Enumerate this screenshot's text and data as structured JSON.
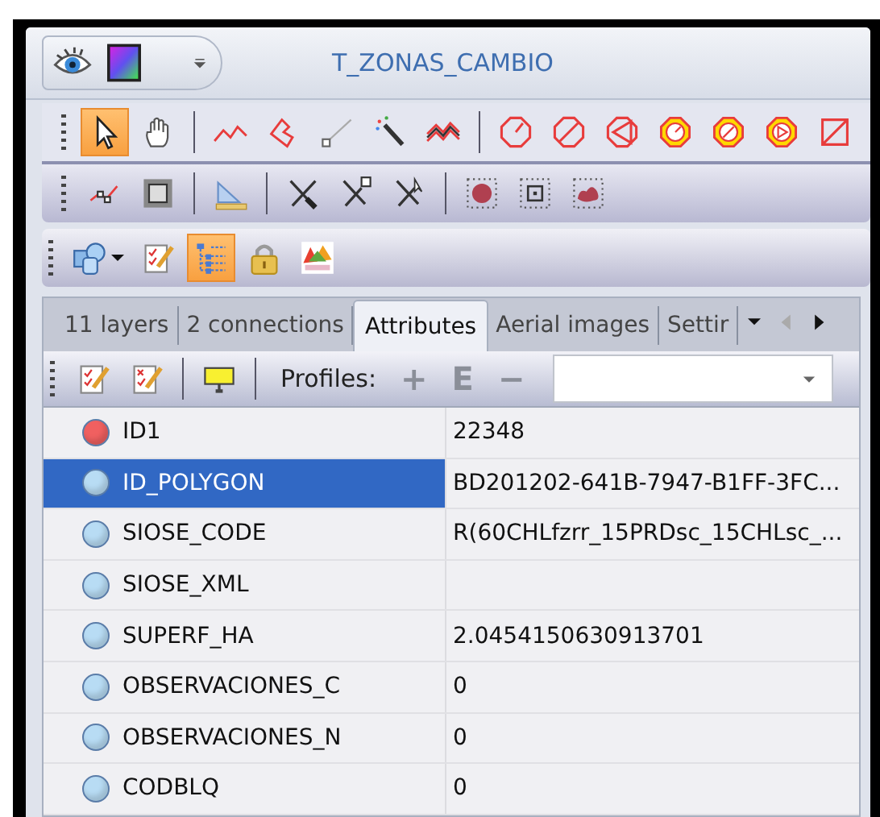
{
  "window": {
    "title": "T_ZONAS_CAMBIO"
  },
  "quick_access": [
    {
      "kind": "eye"
    },
    {
      "kind": "palette"
    },
    {
      "kind": "customize"
    }
  ],
  "toolbars": [
    [
      {
        "kind": "pointer",
        "pressed": true
      },
      {
        "kind": "hand",
        "pressed": false
      },
      {
        "kind": "separator"
      },
      {
        "kind": "polyline",
        "pressed": false
      },
      {
        "kind": "polygon",
        "pressed": false
      },
      {
        "kind": "segment",
        "pressed": false
      },
      {
        "kind": "wand",
        "pressed": false
      },
      {
        "kind": "zigzag",
        "pressed": false
      },
      {
        "kind": "separator"
      },
      {
        "kind": "octagon",
        "pressed": false
      },
      {
        "kind": "octaslash",
        "pressed": false
      },
      {
        "kind": "octaplay",
        "pressed": false
      },
      {
        "kind": "ring",
        "pressed": false
      },
      {
        "kind": "ringslash",
        "pressed": false
      },
      {
        "kind": "ringplay",
        "pressed": false
      },
      {
        "kind": "squareslash",
        "pressed": false
      }
    ],
    [
      {
        "kind": "vertices",
        "pressed": false
      },
      {
        "kind": "hatch",
        "pressed": false
      },
      {
        "kind": "separator"
      },
      {
        "kind": "setsquare",
        "pressed": false
      },
      {
        "kind": "separator"
      },
      {
        "kind": "knife",
        "pressed": false
      },
      {
        "kind": "knifesquare",
        "pressed": false
      },
      {
        "kind": "knifecursor",
        "pressed": false
      },
      {
        "kind": "separator"
      },
      {
        "kind": "dotcircle",
        "pressed": false
      },
      {
        "kind": "dotsquare",
        "pressed": false
      },
      {
        "kind": "dotblob",
        "pressed": false
      }
    ],
    [
      {
        "kind": "shapes",
        "pressed": false
      },
      {
        "kind": "checklist",
        "pressed": false
      },
      {
        "kind": "tree",
        "pressed": true
      },
      {
        "kind": "lock",
        "pressed": false
      },
      {
        "kind": "logo",
        "pressed": false
      }
    ]
  ],
  "tabs": [
    {
      "label": "11 layers",
      "selected": false
    },
    {
      "label": "2 connections",
      "selected": false
    },
    {
      "label": "Attributes",
      "selected": true
    },
    {
      "label": "Aerial images",
      "selected": false
    },
    {
      "label": "Settir",
      "selected": false
    }
  ],
  "tab_nav": [
    {
      "kind": "menu",
      "disabled": false
    },
    {
      "kind": "left",
      "disabled": true
    },
    {
      "kind": "right",
      "disabled": false
    }
  ],
  "attr_toolbar": {
    "tools": [
      {
        "kind": "checklist"
      },
      {
        "kind": "checkx"
      },
      {
        "kind": "separator"
      },
      {
        "kind": "sign"
      },
      {
        "kind": "separator"
      }
    ],
    "profiles_label": "Profiles:",
    "profile_buttons": [
      {
        "label": "+",
        "disabled": true
      },
      {
        "label": "E",
        "disabled": true
      },
      {
        "label": "−",
        "disabled": true
      }
    ]
  },
  "rows": [
    {
      "name": "ID1",
      "value": "22348",
      "color": "#f06060",
      "selected": false
    },
    {
      "name": "ID_POLYGON",
      "value": "BD201202-641B-7947-B1FF-3FC...",
      "color": "#b8dcf4",
      "selected": true
    },
    {
      "name": "SIOSE_CODE",
      "value": "R(60CHLfzrr_15PRDsc_15CHLsc_...",
      "color": "#b8dcf4",
      "selected": false
    },
    {
      "name": "SIOSE_XML",
      "color": "#b8dcf4",
      "selected": false
    },
    {
      "name": "SUPERF_HA",
      "value": "2.0454150630913701",
      "color": "#b8dcf4",
      "selected": false
    },
    {
      "name": "OBSERVACIONES_C",
      "value": "0",
      "color": "#b8dcf4",
      "selected": false
    },
    {
      "name": "OBSERVACIONES_N",
      "value": "0",
      "color": "#b8dcf4",
      "selected": false
    },
    {
      "name": "CODBLQ",
      "value": "0",
      "color": "#b8dcf4",
      "selected": false
    }
  ]
}
